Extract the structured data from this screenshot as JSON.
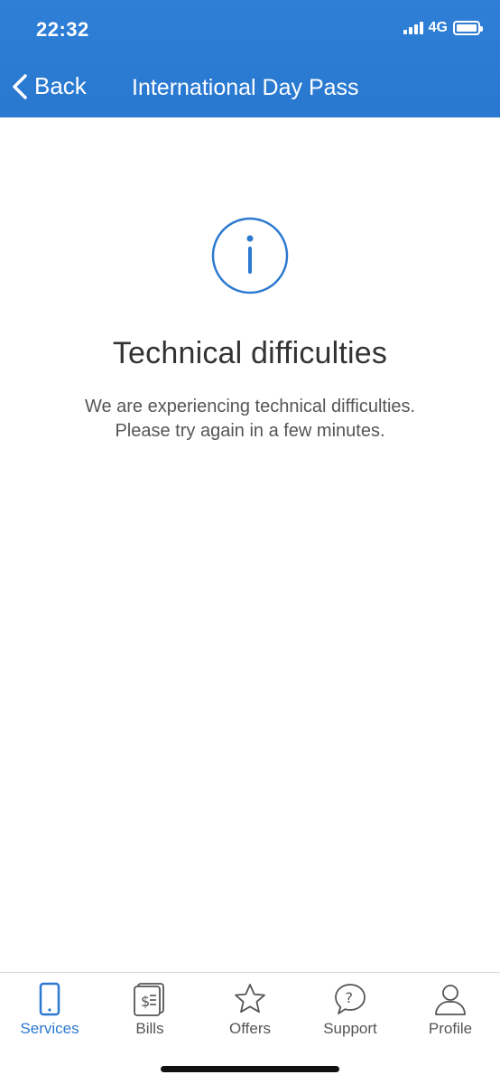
{
  "status_bar": {
    "time": "22:32",
    "network": "4G"
  },
  "nav": {
    "back_label": "Back",
    "title": "International Day Pass"
  },
  "error": {
    "icon": "info-icon",
    "title": "Technical difficulties",
    "message_line1": "We are experiencing technical difficulties.",
    "message_line2": "Please try again in a few minutes."
  },
  "tabbar": {
    "active": "Services",
    "items": [
      {
        "label": "Services",
        "icon": "phone-icon"
      },
      {
        "label": "Bills",
        "icon": "bill-icon"
      },
      {
        "label": "Offers",
        "icon": "star-icon"
      },
      {
        "label": "Support",
        "icon": "question-bubble-icon"
      },
      {
        "label": "Profile",
        "icon": "person-icon"
      }
    ]
  },
  "colors": {
    "header": "#2b7bd3",
    "accent": "#2b79d0",
    "text_dark": "#333333",
    "text_muted": "#555555"
  }
}
